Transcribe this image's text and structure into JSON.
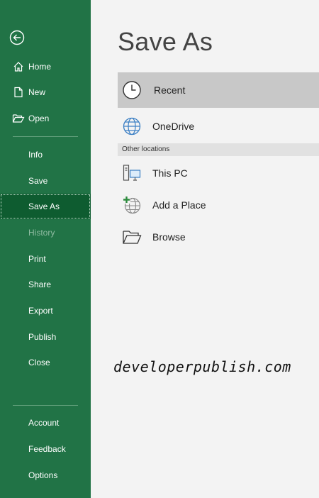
{
  "sidebar": {
    "back_icon": "back-arrow-icon",
    "items": [
      {
        "label": "Home",
        "icon": "home-icon"
      },
      {
        "label": "New",
        "icon": "new-document-icon"
      },
      {
        "label": "Open",
        "icon": "folder-open-icon"
      },
      {
        "label": "Info"
      },
      {
        "label": "Save"
      },
      {
        "label": "Save As",
        "active": true
      },
      {
        "label": "History",
        "disabled": true
      },
      {
        "label": "Print"
      },
      {
        "label": "Share"
      },
      {
        "label": "Export"
      },
      {
        "label": "Publish"
      },
      {
        "label": "Close"
      },
      {
        "label": "Account"
      },
      {
        "label": "Feedback"
      },
      {
        "label": "Options"
      }
    ]
  },
  "main": {
    "title": "Save As",
    "recent_label": "Recent",
    "onedrive_label": "OneDrive",
    "other_locations_header": "Other locations",
    "this_pc_label": "This PC",
    "add_place_label": "Add a Place",
    "browse_label": "Browse"
  },
  "watermark": "developerpublish.com",
  "colors": {
    "sidebar_bg": "#217346",
    "active_bg": "#0e5c30",
    "main_bg": "#f3f3f3",
    "selected_bg": "#c8c8c8"
  }
}
